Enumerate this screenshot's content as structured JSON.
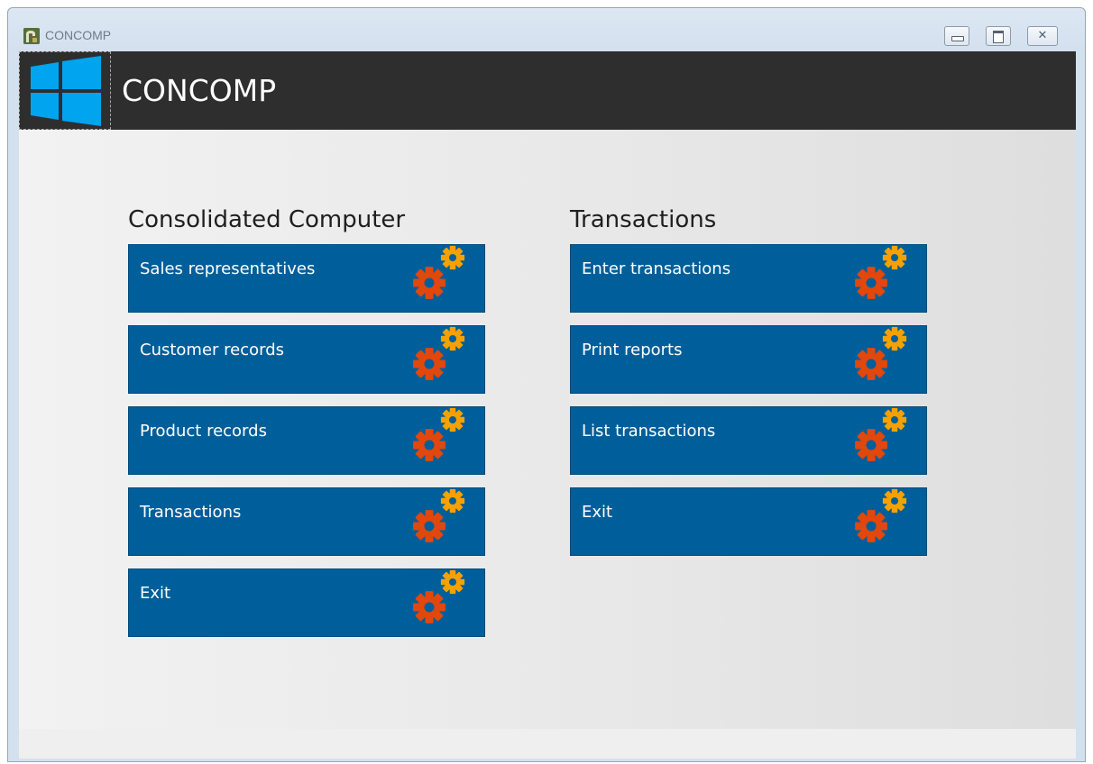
{
  "window": {
    "title": "CONCOMP"
  },
  "header": {
    "title": "CONCOMP"
  },
  "groups": [
    {
      "title": "Consolidated Computer",
      "tiles": [
        {
          "label": "Sales representatives"
        },
        {
          "label": "Customer records"
        },
        {
          "label": "Product records"
        },
        {
          "label": "Transactions"
        },
        {
          "label": "Exit"
        }
      ]
    },
    {
      "title": "Transactions",
      "tiles": [
        {
          "label": "Enter transactions"
        },
        {
          "label": "Print reports"
        },
        {
          "label": "List transactions"
        },
        {
          "label": "Exit"
        }
      ]
    }
  ],
  "icons": {
    "header_logo": "windows-logo-icon",
    "tile_icon": "gears-icon",
    "minimize": "minimize-icon",
    "maximize": "maximize-icon",
    "close": "close-icon"
  },
  "colors": {
    "tile_background": "#005f9a",
    "header_background": "#2e2e2e",
    "windows_logo": "#00a4ef",
    "gear_large": "#e2470c",
    "gear_small": "#f7a100"
  }
}
